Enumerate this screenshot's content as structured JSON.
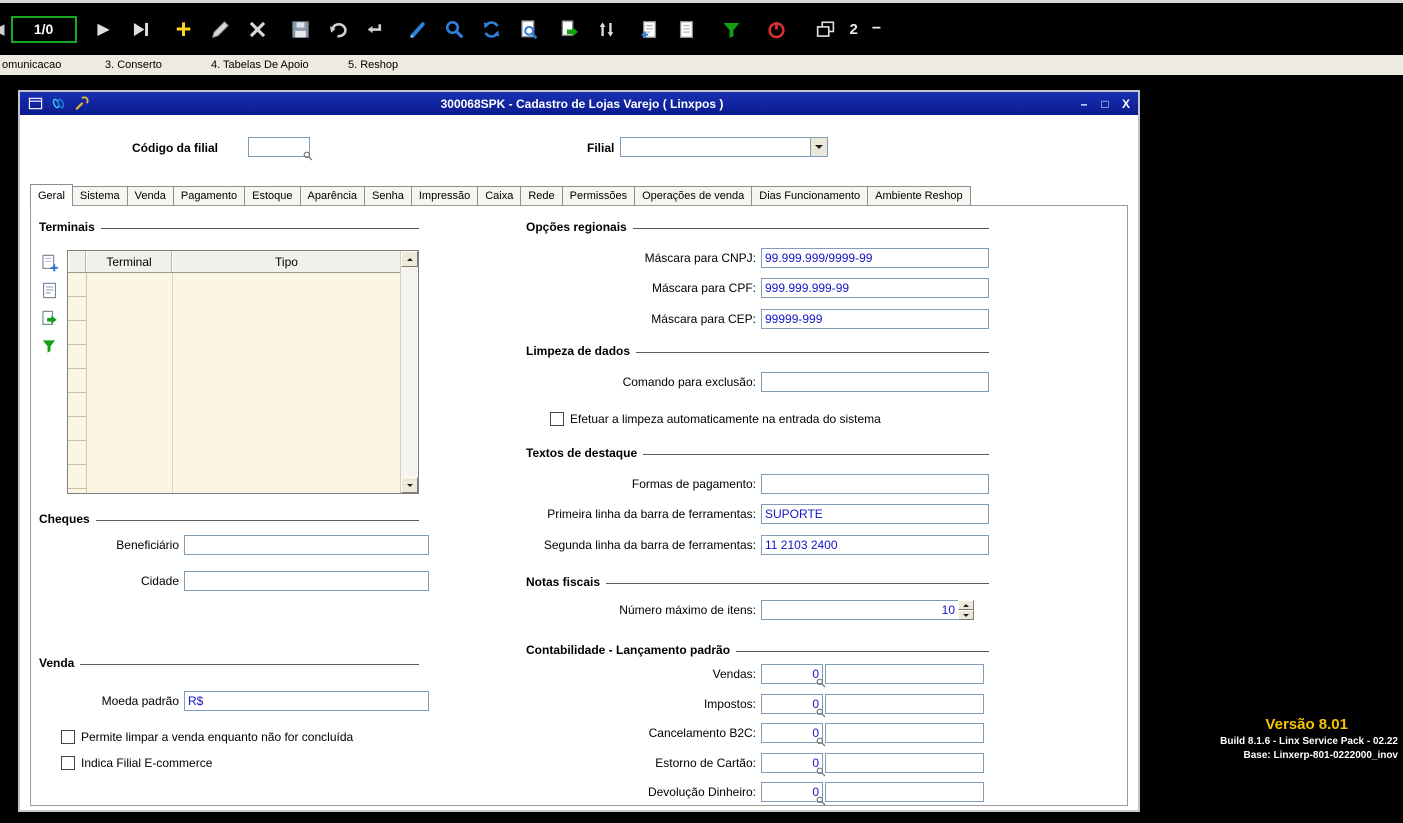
{
  "toolbar": {
    "record_counter": "1/0",
    "open_forms": "2",
    "collapse": "−",
    "icons": [
      "prev-record",
      "play",
      "last-record",
      "add",
      "edit",
      "delete",
      "save",
      "revert",
      "confirm",
      "clear",
      "search",
      "refresh",
      "preview",
      "export",
      "sort",
      "new-document",
      "document",
      "filter",
      "exit",
      "cascade-windows"
    ]
  },
  "menubar": {
    "items": [
      "omunicacao",
      "3. Conserto",
      "4. Tabelas De Apoio",
      "5. Reshop"
    ]
  },
  "window": {
    "title": "300068SPK - Cadastro de Lojas Varejo ( Linxpos )",
    "controls": {
      "minimize": "–",
      "maximize": "□",
      "close": "X"
    },
    "titlebar_icons": [
      "form-icon",
      "links-icon",
      "wrench-icon"
    ]
  },
  "header_fields": {
    "codigo_label": "Código da filial",
    "codigo_value": "",
    "filial_label": "Filial",
    "filial_value": ""
  },
  "tabs": [
    "Geral",
    "Sistema",
    "Venda",
    "Pagamento",
    "Estoque",
    "Aparência",
    "Senha",
    "Impressão",
    "Caixa",
    "Rede",
    "Permissões",
    "Operações de venda",
    "Dias Funcionamento",
    "Ambiente Reshop"
  ],
  "terminais": {
    "caption": "Terminais",
    "columns": [
      "Terminal",
      "Tipo"
    ],
    "rows": [],
    "side_icons": [
      "add-row-icon",
      "detail-icon",
      "export-row-icon",
      "filter-row-icon"
    ]
  },
  "cheques": {
    "caption": "Cheques",
    "fields": [
      {
        "label": "Beneficiário",
        "value": ""
      },
      {
        "label": "Cidade",
        "value": ""
      }
    ]
  },
  "venda": {
    "caption": "Venda",
    "moeda_label": "Moeda padrão",
    "moeda_value": "R$",
    "checkboxes": [
      "Permite limpar a venda enquanto não for concluída",
      "Indica Filial E-commerce"
    ]
  },
  "opcoes_regionais": {
    "caption": "Opções regionais",
    "rows": [
      {
        "label": "Máscara para CNPJ:",
        "value": "99.999.999/9999-99"
      },
      {
        "label": "Máscara para CPF:",
        "value": "999.999.999-99"
      },
      {
        "label": "Máscara para CEP:",
        "value": "99999-999"
      }
    ]
  },
  "limpeza": {
    "caption": "Limpeza de dados",
    "comando_label": "Comando para exclusão:",
    "comando_value": "",
    "checkbox": "Efetuar a limpeza automaticamente na entrada do sistema"
  },
  "textos": {
    "caption": "Textos de destaque",
    "rows": [
      {
        "label": "Formas de pagamento:",
        "value": ""
      },
      {
        "label": "Primeira linha da barra de ferramentas:",
        "value": "SUPORTE"
      },
      {
        "label": "Segunda linha da barra de ferramentas:",
        "value": "11 2103 2400"
      }
    ]
  },
  "notas": {
    "caption": "Notas fiscais",
    "label": "Número máximo de itens:",
    "value": "10"
  },
  "contabilidade": {
    "caption": "Contabilidade - Lançamento padrão",
    "rows": [
      {
        "label": "Vendas:",
        "code": "0",
        "desc": ""
      },
      {
        "label": "Impostos:",
        "code": "0",
        "desc": ""
      },
      {
        "label": "Cancelamento B2C:",
        "code": "0",
        "desc": ""
      },
      {
        "label": "Estorno de Cartão:",
        "code": "0",
        "desc": ""
      },
      {
        "label": "Devolução Dinheiro:",
        "code": "0",
        "desc": ""
      }
    ]
  },
  "version": {
    "line1": "Versão 8.01",
    "line2": "Build 8.1.6 - Linx Service Pack - 02.22",
    "line3": "Base: Linxerp-801-0222000_inov"
  },
  "colors": {
    "titlebar": "#0d1d9e",
    "accent_green": "#14A014",
    "accent_blue": "#2F80D8",
    "value_blue": "#1414C8",
    "version_gold": "#F5C400",
    "grid_body": "#FBF6E3"
  }
}
